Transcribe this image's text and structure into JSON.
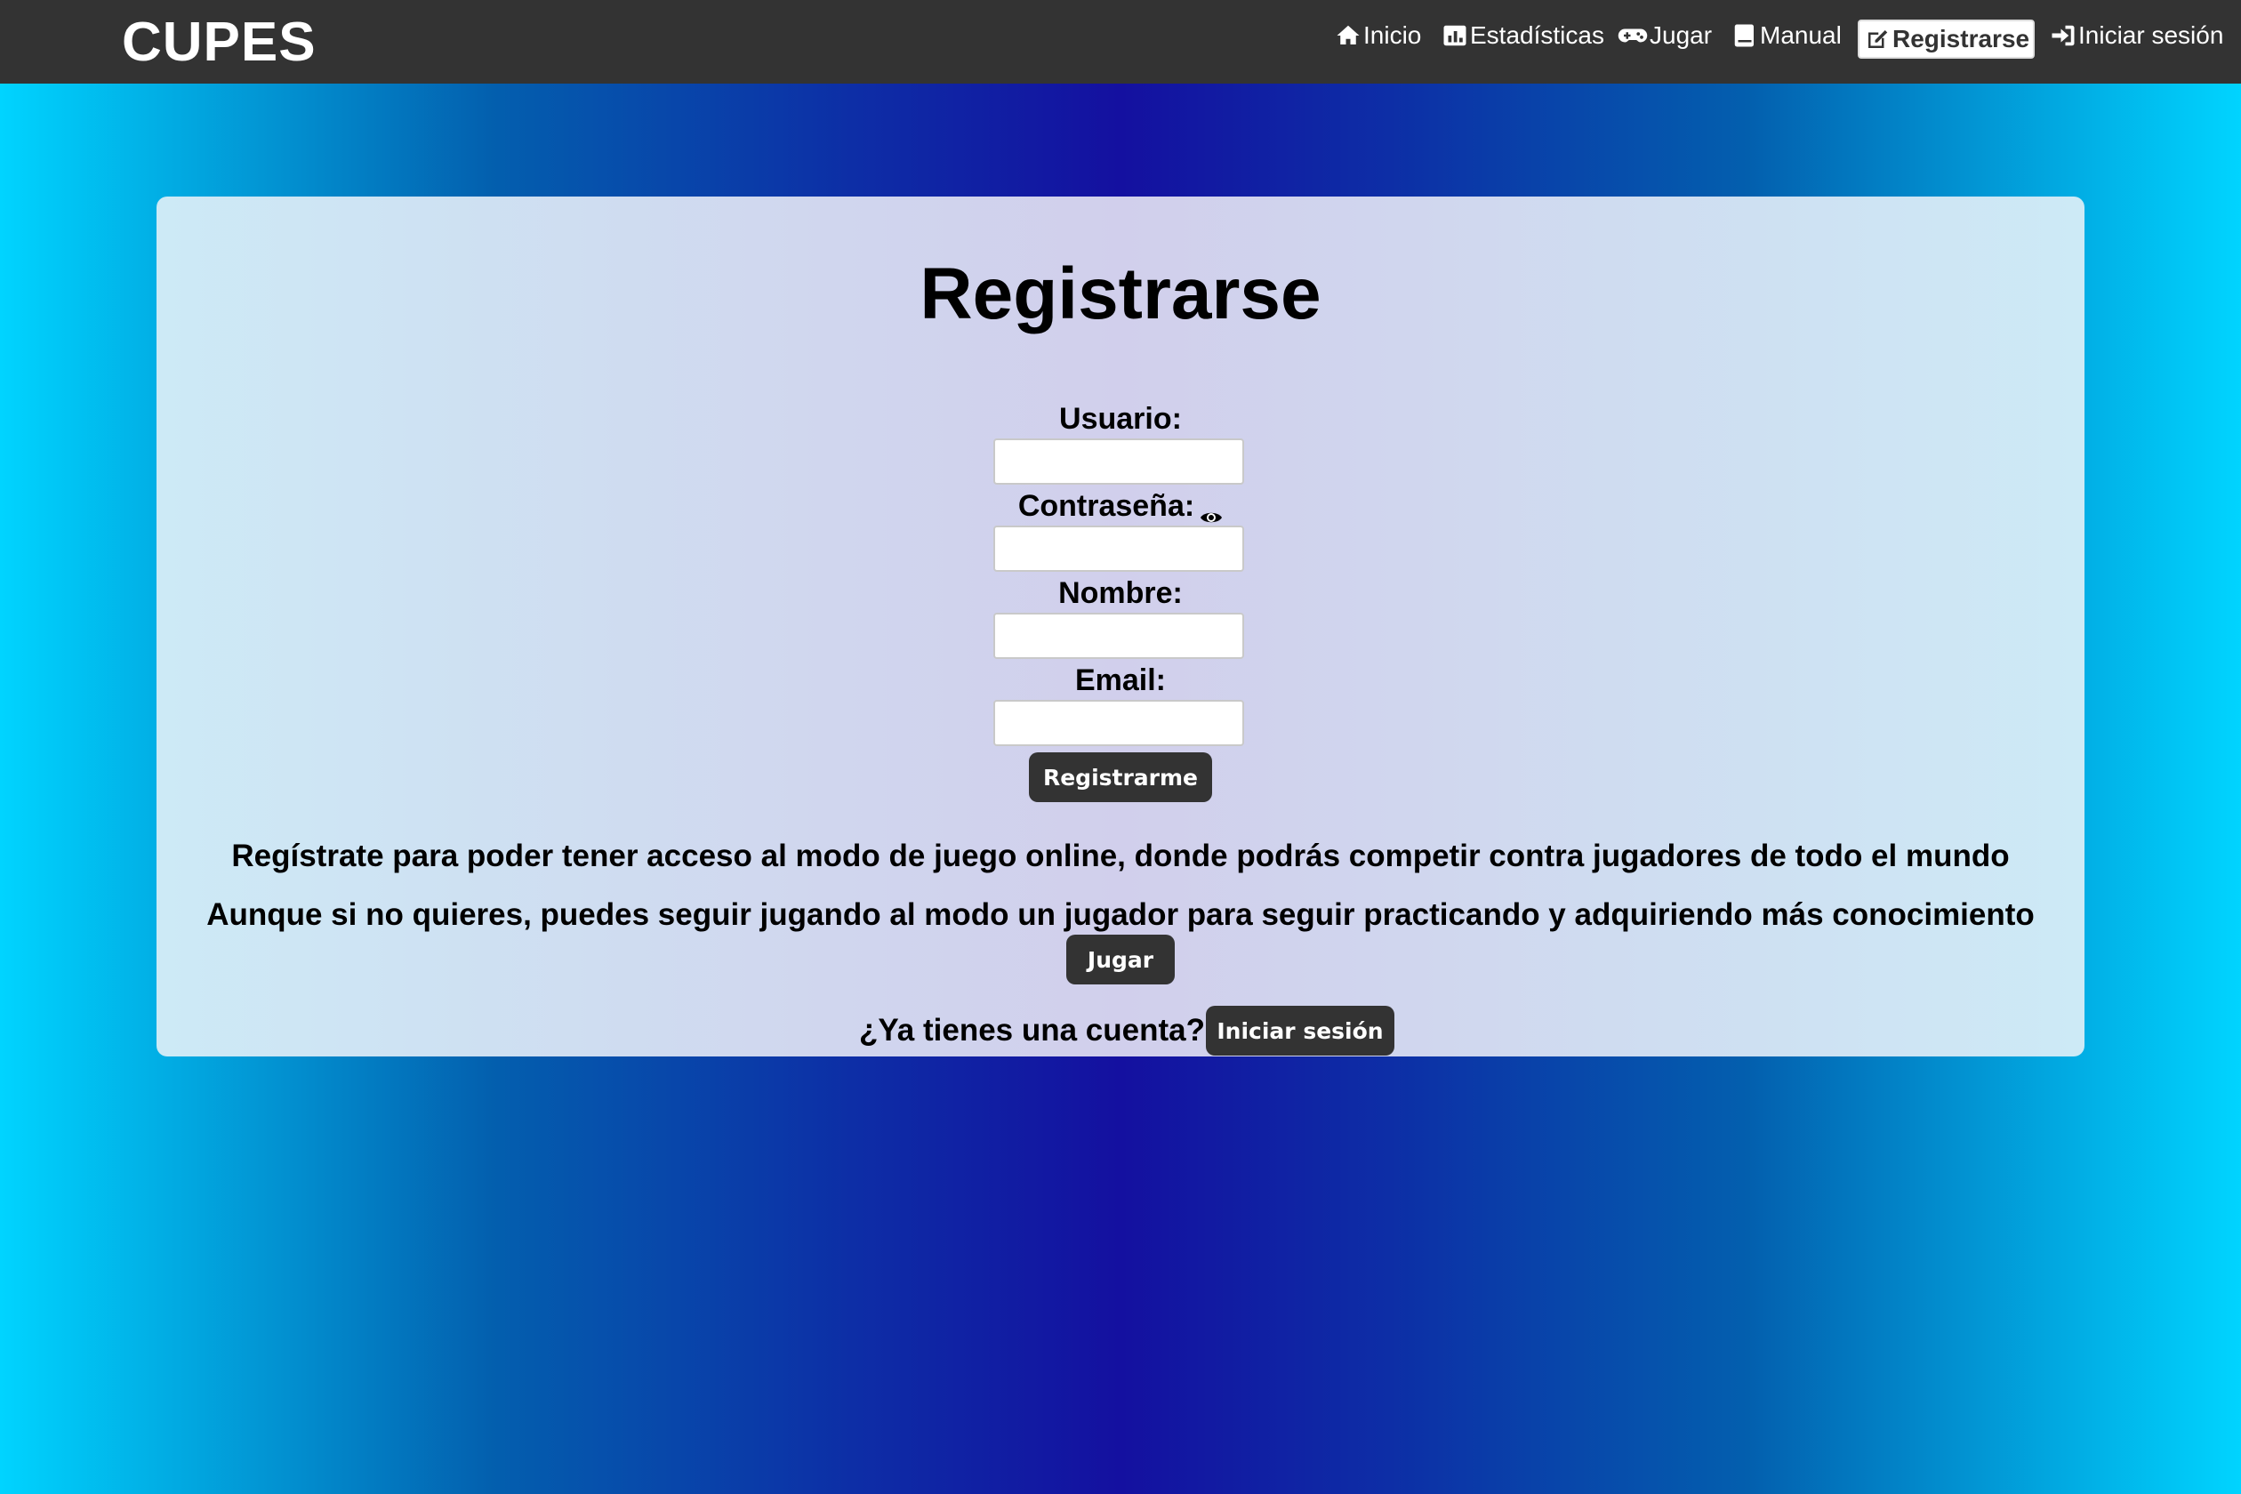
{
  "navbar": {
    "brand": "CUPES",
    "items": [
      {
        "label": "Inicio",
        "icon": "home-icon"
      },
      {
        "label": "Estadísticas",
        "icon": "chart-icon"
      },
      {
        "label": "Jugar",
        "icon": "gamepad-icon"
      },
      {
        "label": "Manual",
        "icon": "book-icon"
      },
      {
        "label": "Registrarse",
        "icon": "edit-icon",
        "active": true
      },
      {
        "label": "Iniciar sesión",
        "icon": "sign-in-icon"
      }
    ]
  },
  "form": {
    "title": "Registrarse",
    "username_label": "Usuario:",
    "username_value": "",
    "password_label": "Contraseña:",
    "password_value": "",
    "name_label": "Nombre:",
    "name_value": "",
    "email_label": "Email:",
    "email_value": "",
    "submit_label": "Registrarme"
  },
  "info": {
    "line1": "Regístrate para poder tener acceso al modo de juego online, donde podrás competir contra jugadores de todo el mundo",
    "line2": "Aunque si no quieres, puedes seguir jugando al modo un jugador para seguir practicando y adquiriendo más conocimiento",
    "play_button": "Jugar",
    "account_question": "¿Ya tienes una cuenta?",
    "login_button": "Iniciar sesión"
  },
  "colors": {
    "navbar_bg": "#333333",
    "button_bg": "#333333",
    "gradient_edge": "#00d4ff",
    "gradient_center": "#1410a0"
  }
}
